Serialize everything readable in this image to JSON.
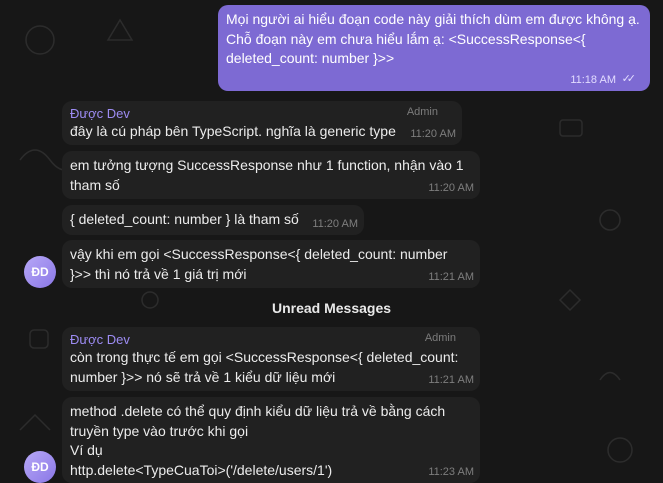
{
  "own_message": {
    "text": "Mọi người ai hiểu đoạn code này giải thích dùm em được không ạ.\nChỗ đoạn này em chưa hiểu lắm ạ: <SuccessResponse<{ deleted_count: number }>>",
    "time": "11:18 AM"
  },
  "sender_name": "Được Dev",
  "admin_badge": "Admin",
  "avatar_initials": "ĐD",
  "unread_label": "Unread Messages",
  "messages": [
    {
      "text": "đây là cú pháp bên TypeScript. nghĩa là generic type",
      "time": "11:20 AM"
    },
    {
      "text": "em tưởng tượng SuccessResponse như 1 function, nhận vào 1\ntham số",
      "time": "11:20 AM"
    },
    {
      "text": "{ deleted_count: number } là tham số",
      "time": "11:20 AM"
    },
    {
      "text": "vậy khi em gọi <SuccessResponse<{ deleted_count: number\n}>> thì nó trả về 1 giá trị mới",
      "time": "11:21 AM"
    },
    {
      "text": "còn trong thực tế em gọi <SuccessResponse<{ deleted_count:\nnumber }>> nó sẽ trả về 1 kiểu dữ liệu mới",
      "time": "11:21 AM"
    },
    {
      "text": "method .delete có thể quy định kiểu dữ liệu trả về bằng cách\ntruyền type vào trước khi gọi\nVí dụ\nhttp.delete<TypeCuaToi>('/delete/users/1')",
      "time": "11:23 AM"
    }
  ],
  "colors": {
    "own_bubble": "#7d6ad3",
    "bubble": "#212121",
    "sender": "#9d8cf3",
    "background": "#171717"
  },
  "icons": [
    "double-check-icon",
    "doodle-pattern-background"
  ]
}
